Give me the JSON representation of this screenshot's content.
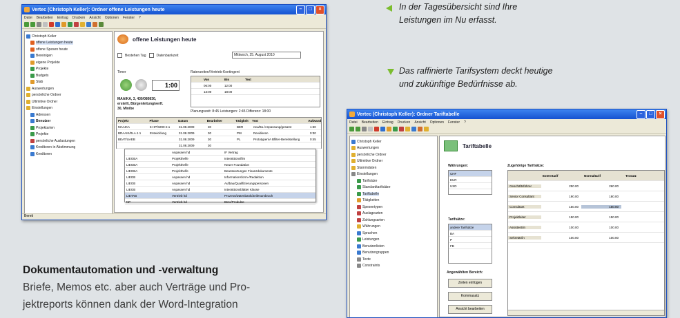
{
  "window1": {
    "title": "Vertec (Christoph Keller): Ordner offene Leistungen heute",
    "menu": [
      "Datei",
      "Bearbeiten",
      "Eintrag",
      "Drucken",
      "Ansicht",
      "Optionen",
      "Fenster",
      "?"
    ],
    "tree": [
      "Christoph Keller",
      "offene Leistungen heute",
      "offene Spesen heute",
      "Bereinigen",
      "eigene Projekte",
      "Projekte",
      "Budgets",
      "Stab",
      "Auswertungen",
      "persönliche Ordner",
      "Ultimitive Ordner",
      "Einstellungen",
      "Adressen",
      "Benutzer",
      "Projektarten",
      "Projekte",
      "persönliche Auslastungen",
      "Kreditoren in Abstimmung",
      "Kreditoren"
    ],
    "header_title": "offene Leistungen heute",
    "checkbox1": "Bestehen Tag",
    "checkbox2": "Datenbankzeit",
    "date_value": "Mittwoch, 25. August 2010",
    "timer_label": "Timer",
    "timer_value": "1:00",
    "project_line1": "MAAIKA, 3, 430/080830,",
    "project_line2": "erstellt, Bürgenleitung/verlf.",
    "project_line3": "30, Minibe",
    "sub_title": "Ratenzeiten/Vertrieb-Kontingent",
    "sub_cols": [
      "Von",
      "Bis",
      "Text"
    ],
    "sub_rows": [
      [
        "06:00",
        "12:00"
      ],
      [
        "13:00",
        "18:00"
      ]
    ],
    "summary": "Planungszeit: 8:45    Leistungen: 2:45    Differenz: 18:00",
    "grid_cols": [
      "Projekt",
      "Phase",
      "Datum",
      "Bearbeiter",
      "Tätigkeit",
      "Text",
      "Aufwand"
    ],
    "grid_rows": [
      [
        "MAAIKA",
        "5-HP/0290-2.1",
        "31.08.2009",
        "30",
        "BER",
        "neu/Bo./Anpassung/gesamt",
        "1:30"
      ],
      [
        "BDAAIK/0LA.1.1",
        "Entwicklung",
        "31.08.2009",
        "30",
        "PM",
        "Revidieren",
        "0:30"
      ],
      [
        "BEAT/UAEB",
        "",
        "31.08.2009",
        "30",
        "PL",
        "Prototypen/A Bfilter-Bereitstellung",
        "0:45"
      ],
      [
        "",
        "",
        "31.08.2009",
        "30",
        "",
        "",
        ""
      ]
    ],
    "dropdown_rows": [
      [
        "",
        "Anpassen hd",
        "IF Vertrag"
      ],
      [
        "LIEGBA",
        "Projekthelfe",
        "Interaktionsfilm"
      ],
      [
        "LIEGBA",
        "Projekthelfe",
        "Neuer Foundation"
      ],
      [
        "LIEGBA",
        "Projekthelfe",
        "Beantwortungen Finanzdokumente"
      ],
      [
        "LIEGB",
        "Anpassen hd",
        "Informationsform-/Redaktion"
      ],
      [
        "LIEGB",
        "Anpassen hd",
        "Aufbau/Qualifizierungspersonen"
      ],
      [
        "LIEGB",
        "Anpassen hd",
        "Interaktionsblätter Klasse"
      ],
      [
        "LIETAB",
        "Vertrieb hd",
        "Prozess/Datenbank/Zeilenumbruch"
      ],
      [
        "NP",
        "Vertrieb hd",
        "Büro/Produkte"
      ]
    ],
    "status": "Bereit"
  },
  "caption1": {
    "line1": "In der Tagesübersicht sind Ihre",
    "line2": "Leistungen im Nu erfasst."
  },
  "caption2": {
    "line1": "Das raffinierte Tarifsystem deckt heutige",
    "line2": "und zukünftige Bedürfnisse ab."
  },
  "window2": {
    "title": "Vertec (Christoph Keller): Ordner Tariftabelle",
    "menu": [
      "Datei",
      "Bearbeiten",
      "Eintrag",
      "Drucken",
      "Ansicht",
      "Optionen",
      "Fenster",
      "?"
    ],
    "tree": [
      "Christoph Keller",
      "Auswertungen",
      "persönliche Ordner",
      "Ultimitive Ordner",
      "Stammdaten",
      "Einstellungen",
      "Tarifsätze",
      "Standardtarifsätze",
      "Tariftabelle",
      "Tätigkeiten",
      "Spesentypen",
      "Auslagearten",
      "Zahlungsarten",
      "Währungen",
      "Sprachen",
      "Leistungen",
      "Benutzerlisten",
      "Benutzergruppen",
      "Texte",
      "Constraints"
    ],
    "header_title": "Tariftabelle",
    "waehrungen_label": "Währungen:",
    "waehrungen": [
      "CHF",
      "EUR",
      "USD"
    ],
    "tarifsaetze_label": "Tarifsätze:",
    "tarifsaetze": [
      "andere Tarifsätze",
      "BA",
      "P",
      "FB"
    ],
    "operations_label": "Angewählten Bereich:",
    "btn1": "Zeilen einfügen",
    "btn2": "Kommasatz",
    "btn3": "Ansicht bearbeiten",
    "table_title": "Zugehörige Tarifsätze:",
    "table_cols": [
      "",
      "Externtarif",
      "Normaltarif",
      "Trosatz"
    ],
    "table_rows": [
      [
        "Geschäftsführer",
        "250.00",
        "260.00"
      ],
      [
        "Senior Consultant",
        "190.00",
        "180.00"
      ],
      [
        "Consultant",
        "150.00",
        "150.00"
      ],
      [
        "Projektleiter",
        "150.00",
        "150.00"
      ],
      [
        "Assistent/in",
        "100.00",
        "100.00"
      ],
      [
        "Sekretär/in",
        "100.00",
        "100.00"
      ]
    ]
  },
  "heading": "Dokumentautomation und -verwaltung",
  "paragraph": {
    "line1": "Briefe, Memos etc. aber auch Verträge und Pro-",
    "line2": "jektreports können dank der Word-Integration"
  },
  "colors": {
    "background": "#dfe3e6",
    "triangle": "#7bbd2e",
    "titlebar": "#1552d0"
  }
}
